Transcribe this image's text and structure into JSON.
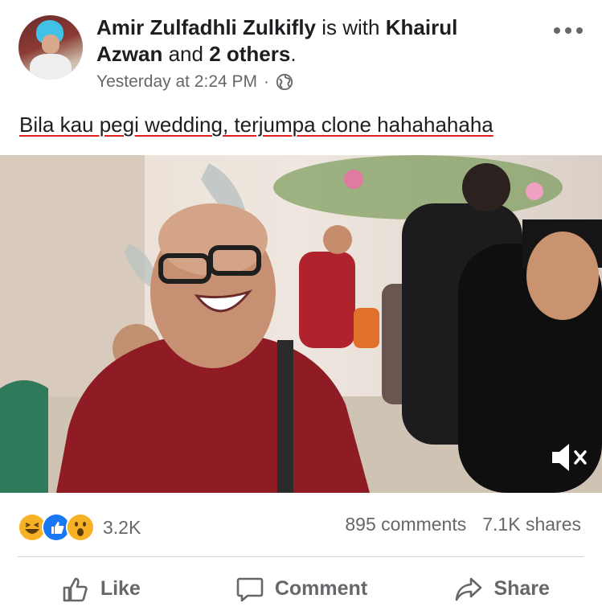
{
  "post": {
    "author": "Amir Zulfadhli Zulkifly",
    "with_text": "is with",
    "tagged_first": "Khairul Azwan",
    "and_text": "and",
    "others": "2 others",
    "period": ".",
    "timestamp": "Yesterday at 2:24 PM",
    "separator": "·",
    "privacy_icon": "globe-icon",
    "caption": "Bila kau pegi wedding, terjumpa clone hahahahaha"
  },
  "stats": {
    "reaction_icons": [
      "haha-icon",
      "like-icon",
      "wow-icon"
    ],
    "reaction_count": "3.2K",
    "comments": "895 comments",
    "shares": "7.1K shares"
  },
  "actions": {
    "like": "Like",
    "comment": "Comment",
    "share": "Share"
  },
  "colors": {
    "like_blue": "#1877f2",
    "haha_yellow": "#f7b125",
    "caption_underline": "#e02020",
    "muted_text": "#65676b"
  }
}
